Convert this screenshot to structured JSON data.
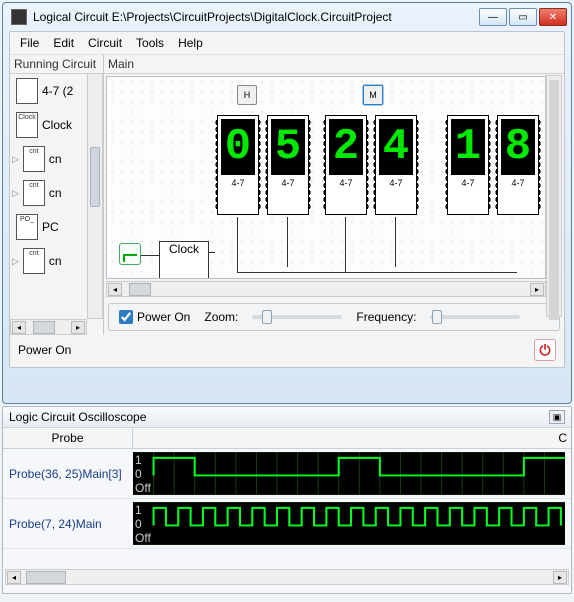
{
  "window": {
    "title": "Logical Circuit E:\\Projects\\CircuitProjects\\DigitalClock.CircuitProject"
  },
  "menu": {
    "file": "File",
    "edit": "Edit",
    "circuit": "Circuit",
    "tools": "Tools",
    "help": "Help"
  },
  "tree": {
    "header": "Running Circuit",
    "items": [
      {
        "label": "4-7 (2",
        "icon": ""
      },
      {
        "label": "Clock",
        "icon": "Clock"
      },
      {
        "label": "cn",
        "icon": "cnt",
        "expandable": true
      },
      {
        "label": "cn",
        "icon": "cnt",
        "expandable": true
      },
      {
        "label": "PC",
        "icon": "PO_"
      },
      {
        "label": "cn",
        "icon": "cnt",
        "expandable": true
      }
    ]
  },
  "main": {
    "header": "Main",
    "segments": [
      {
        "digit": "0",
        "sub": "4-7"
      },
      {
        "digit": "5",
        "sub": "4-7"
      },
      {
        "digit": "2",
        "sub": "4-7"
      },
      {
        "digit": "4",
        "sub": "4-7"
      },
      {
        "digit": "1",
        "sub": "4-7"
      },
      {
        "digit": "8",
        "sub": "4-7"
      }
    ],
    "btnH": "H",
    "btnM": "M",
    "clockLabel": "Clock"
  },
  "controls": {
    "powerOnLabel": "Power On",
    "zoomLabel": "Zoom:",
    "freqLabel": "Frequency:"
  },
  "status": {
    "text": "Power On"
  },
  "scope": {
    "title": "Logic Circuit Oscilloscope",
    "colProbe": "Probe",
    "colOther": "C",
    "rows": [
      {
        "label": "Probe(36, 25)Main[3]",
        "y1": "1",
        "y0": "0",
        "yOff": "Off"
      },
      {
        "label": "Probe(7, 24)Main",
        "y1": "1",
        "y0": "0",
        "yOff": "Off"
      }
    ]
  }
}
